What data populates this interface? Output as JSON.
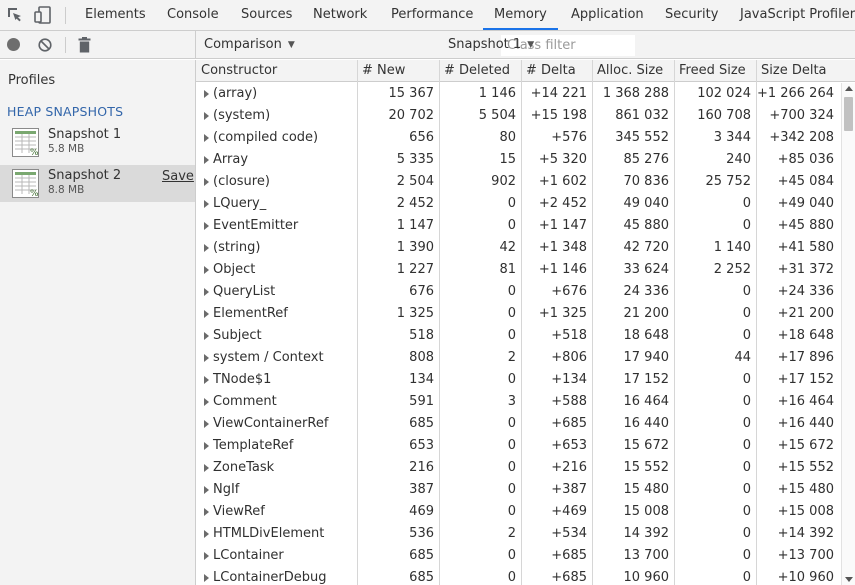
{
  "tabs": [
    {
      "label": "Elements"
    },
    {
      "label": "Console"
    },
    {
      "label": "Sources"
    },
    {
      "label": "Network"
    },
    {
      "label": "Performance"
    },
    {
      "label": "Memory",
      "active": true
    },
    {
      "label": "Application"
    },
    {
      "label": "Security"
    },
    {
      "label": "JavaScript Profiler"
    }
  ],
  "icons": {
    "inspect": "inspect-element-icon",
    "device": "device-toolbar-icon",
    "record": "record-icon",
    "clear": "clear-all-profiles-icon",
    "trash": "collect-garbage-icon",
    "snapshot": "heap-snapshot-icon"
  },
  "toolbar": {
    "view_mode": "Comparison",
    "class_filter_placeholder": "Class filter",
    "base_snapshot": "Snapshot 1"
  },
  "sidebar": {
    "title": "Profiles",
    "section": "HEAP SNAPSHOTS",
    "snapshots": [
      {
        "name": "Snapshot 1",
        "size": "5.8 MB"
      },
      {
        "name": "Snapshot 2",
        "size": "8.8 MB",
        "selected": true,
        "save_label": "Save"
      }
    ]
  },
  "table": {
    "columns": [
      "Constructor",
      "# New",
      "# Deleted",
      "# Delta",
      "Alloc. Size",
      "Freed Size",
      "Size Delta"
    ],
    "rows": [
      [
        "(array)",
        "15 367",
        "1 146",
        "+14 221",
        "1 368 288",
        "102 024",
        "+1 266 264"
      ],
      [
        "(system)",
        "20 702",
        "5 504",
        "+15 198",
        "861 032",
        "160 708",
        "+700 324"
      ],
      [
        "(compiled code)",
        "656",
        "80",
        "+576",
        "345 552",
        "3 344",
        "+342 208"
      ],
      [
        "Array",
        "5 335",
        "15",
        "+5 320",
        "85 276",
        "240",
        "+85 036"
      ],
      [
        "(closure)",
        "2 504",
        "902",
        "+1 602",
        "70 836",
        "25 752",
        "+45 084"
      ],
      [
        "LQuery_",
        "2 452",
        "0",
        "+2 452",
        "49 040",
        "0",
        "+49 040"
      ],
      [
        "EventEmitter",
        "1 147",
        "0",
        "+1 147",
        "45 880",
        "0",
        "+45 880"
      ],
      [
        "(string)",
        "1 390",
        "42",
        "+1 348",
        "42 720",
        "1 140",
        "+41 580"
      ],
      [
        "Object",
        "1 227",
        "81",
        "+1 146",
        "33 624",
        "2 252",
        "+31 372"
      ],
      [
        "QueryList",
        "676",
        "0",
        "+676",
        "24 336",
        "0",
        "+24 336"
      ],
      [
        "ElementRef",
        "1 325",
        "0",
        "+1 325",
        "21 200",
        "0",
        "+21 200"
      ],
      [
        "Subject",
        "518",
        "0",
        "+518",
        "18 648",
        "0",
        "+18 648"
      ],
      [
        "system / Context",
        "808",
        "2",
        "+806",
        "17 940",
        "44",
        "+17 896"
      ],
      [
        "TNode$1",
        "134",
        "0",
        "+134",
        "17 152",
        "0",
        "+17 152"
      ],
      [
        "Comment",
        "591",
        "3",
        "+588",
        "16 464",
        "0",
        "+16 464"
      ],
      [
        "ViewContainerRef",
        "685",
        "0",
        "+685",
        "16 440",
        "0",
        "+16 440"
      ],
      [
        "TemplateRef",
        "653",
        "0",
        "+653",
        "15 672",
        "0",
        "+15 672"
      ],
      [
        "ZoneTask",
        "216",
        "0",
        "+216",
        "15 552",
        "0",
        "+15 552"
      ],
      [
        "NgIf",
        "387",
        "0",
        "+387",
        "15 480",
        "0",
        "+15 480"
      ],
      [
        "ViewRef",
        "469",
        "0",
        "+469",
        "15 008",
        "0",
        "+15 008"
      ],
      [
        "HTMLDivElement",
        "536",
        "2",
        "+534",
        "14 392",
        "0",
        "+14 392"
      ],
      [
        "LContainer",
        "685",
        "0",
        "+685",
        "13 700",
        "0",
        "+13 700"
      ],
      [
        "LContainerDebug",
        "685",
        "0",
        "+685",
        "10 960",
        "0",
        "+10 960"
      ]
    ]
  }
}
